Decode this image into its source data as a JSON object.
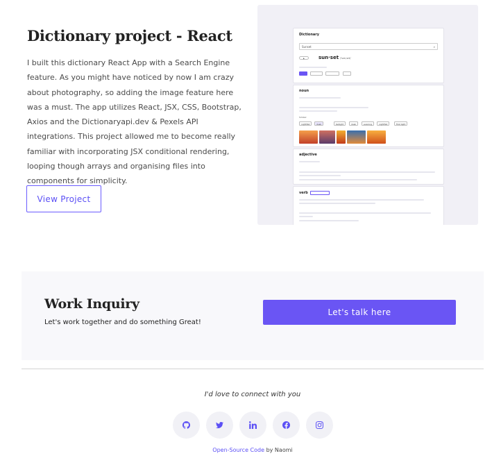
{
  "project": {
    "title": "Dictionary project - React",
    "description": "I built this dictionary React App with a Search Engine feature. As you might have noticed by now I am crazy about photography, so adding the image feature here was a must. The app utilizes React, JSX, CSS, Bootstrap, Axios and the Dictionaryapi.dev & Pexels API integrations. This project allowed me to become really familiar with incorporating JSX conditional rendering, looping though arrays and organising files into components for simplicity.",
    "view_button": "View Project"
  },
  "preview": {
    "app_title": "Dictionary",
    "search_value": "Sunset",
    "word": "sun·set",
    "phonetic": "/'sʌnˌsɛt/",
    "noun_label": "noun",
    "adjective_label": "adjective",
    "verb_label": "verb",
    "similar_label": "Similar:",
    "similar_chips": [
      "nightfall",
      "dusk",
      "twilight",
      "dusk",
      "evening",
      "nightfall",
      "first light"
    ],
    "image_colors": [
      "#e0602a",
      "#c9513c",
      "#f08a2a",
      "#3a6fae",
      "#e8862c"
    ]
  },
  "inquiry": {
    "title": "Work Inquiry",
    "subtitle": "Let's work together and do something Great!",
    "button": "Let's talk here"
  },
  "connect": {
    "text": "I'd love to connect with you"
  },
  "socials": [
    {
      "name": "github-icon"
    },
    {
      "name": "twitter-icon"
    },
    {
      "name": "linkedin-icon"
    },
    {
      "name": "facebook-icon"
    },
    {
      "name": "instagram-icon"
    }
  ],
  "footer": {
    "link_text": "Open-Source Code",
    "suffix": " by Naomi"
  },
  "colors": {
    "accent": "#6a55f4",
    "inquiry_bg": "#f8f8fb",
    "social_bg": "#f1f1f6"
  }
}
